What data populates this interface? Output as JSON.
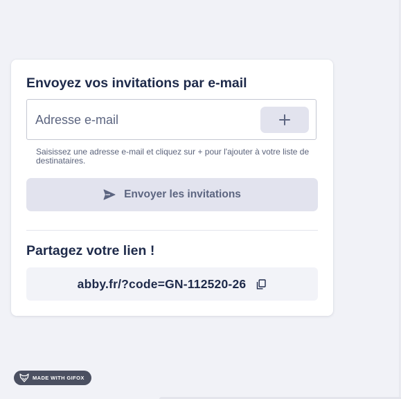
{
  "invite_card": {
    "title": "Envoyez vos invitations par e-mail",
    "email_input": {
      "placeholder": "Adresse e-mail",
      "value": ""
    },
    "add_button_icon": "plus-icon",
    "helper_text": "Saisissez une adresse e-mail et cliquez sur + pour l'ajouter à votre liste de destinataires.",
    "send_button": {
      "icon": "send-icon",
      "label": "Envoyer les invitations"
    }
  },
  "share": {
    "title": "Partagez votre lien !",
    "link": "abby.fr/?code=GN-112520-26",
    "copy_icon": "copy-icon"
  },
  "badge": {
    "label": "MADE WITH GIFOX",
    "icon": "fox-icon"
  },
  "colors": {
    "page_background": "#f1f2f7",
    "card_background": "#ffffff",
    "heading_text": "#1e2a4a",
    "muted_text": "#5c6580",
    "button_background": "#e2e3ee",
    "link_box_background": "#f2f3f8",
    "badge_background": "#4b5061"
  }
}
